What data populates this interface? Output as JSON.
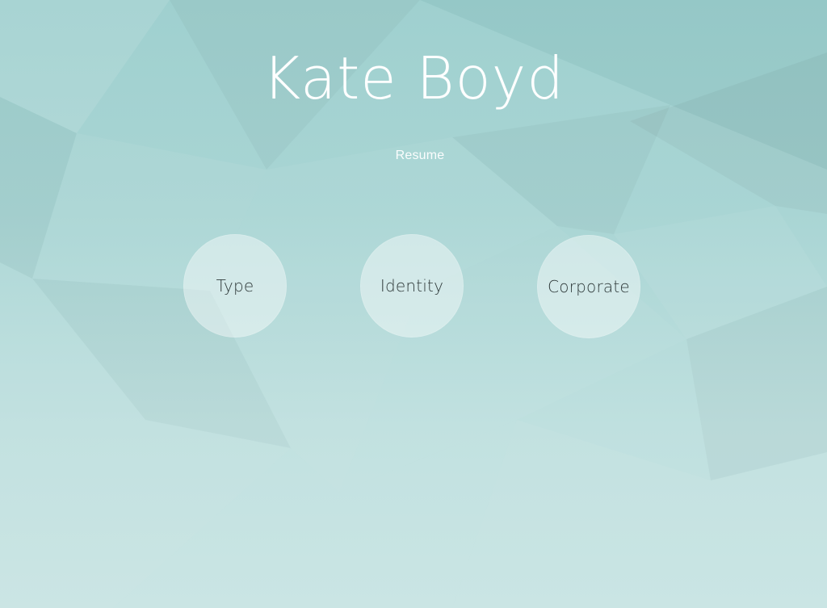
{
  "header": {
    "name": "Kate Boyd",
    "subtitle": "Resume"
  },
  "nav": {
    "items": [
      {
        "label": "Type"
      },
      {
        "label": "Identity"
      },
      {
        "label": "Corporate"
      }
    ]
  },
  "theme": {
    "background": "#a9d5d4",
    "circle_fill": "#ffffff",
    "text_dark": "#2f3a3a",
    "text_light": "#ffffff"
  }
}
